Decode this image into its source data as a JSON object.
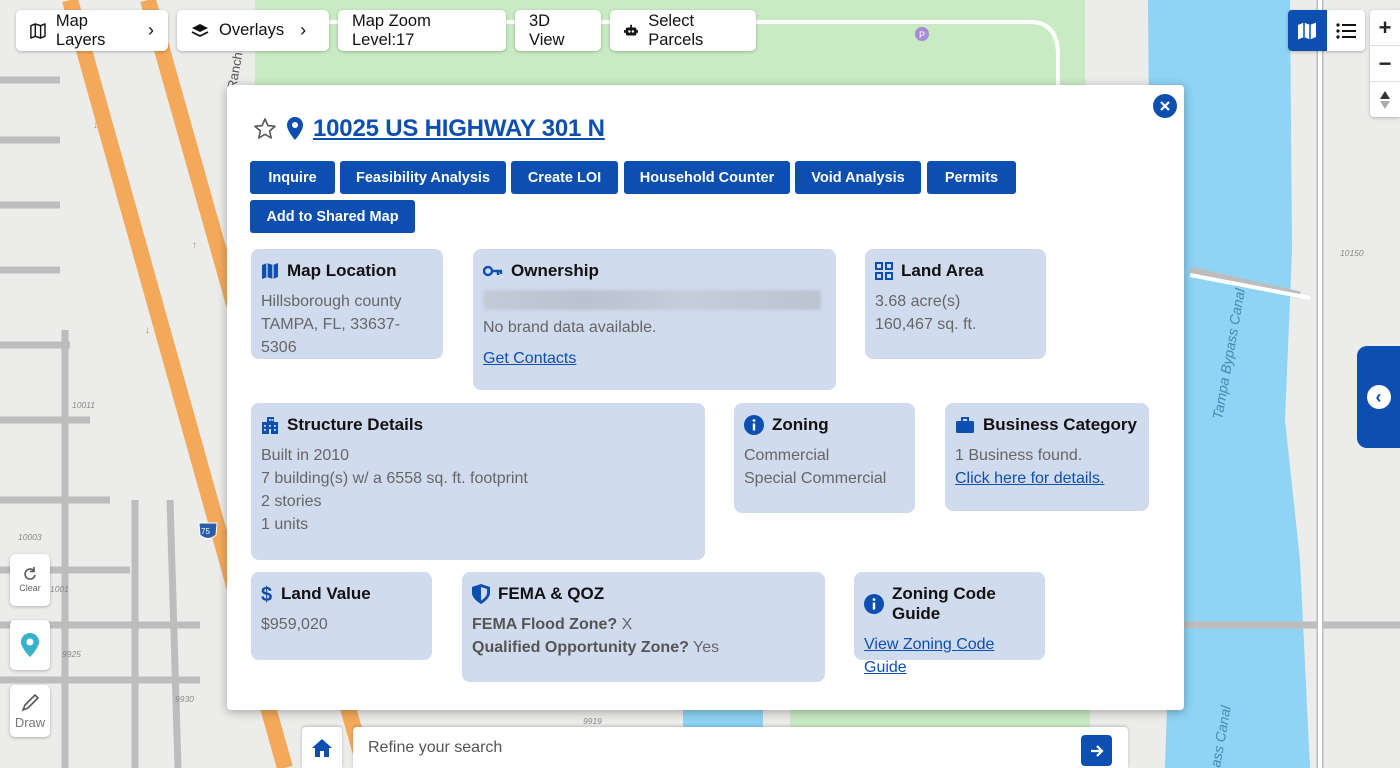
{
  "toolbar": {
    "map_layers": "Map Layers",
    "overlays": "Overlays",
    "zoom_level": "Map Zoom Level:17",
    "view_3d": "3D View",
    "select_parcels": "Select Parcels"
  },
  "map": {
    "labels": [
      "Ranch",
      "10011",
      "10003",
      "1001",
      "9925",
      "9930",
      "9919",
      "10150",
      "Tampa Bypass Canal",
      "ass Canal",
      "75"
    ],
    "clear_label": "Clear",
    "draw_label": "Draw"
  },
  "property": {
    "address": "10025 US HIGHWAY 301 N",
    "actions": [
      "Inquire",
      "Feasibility Analysis",
      "Create LOI",
      "Household Counter",
      "Void Analysis",
      "Permits",
      "Add to Shared Map"
    ],
    "map_location": {
      "title": "Map Location",
      "county": "Hillsborough county",
      "city": "TAMPA, FL, 33637-5306"
    },
    "ownership": {
      "title": "Ownership",
      "brand": "No brand data available.",
      "link": "Get Contacts"
    },
    "land_area": {
      "title": "Land Area",
      "acres": "3.68 acre(s)",
      "sqft": "160,467 sq. ft."
    },
    "structure": {
      "title": "Structure Details",
      "built": "Built in 2010",
      "buildings": "7 building(s) w/ a 6558 sq. ft. footprint",
      "stories": "2 stories",
      "units": "1 units"
    },
    "zoning": {
      "title": "Zoning",
      "line1": "Commercial",
      "line2": "Special Commercial"
    },
    "business": {
      "title": "Business Category",
      "found": "1 Business found.",
      "link": "Click here for details."
    },
    "land_value": {
      "title": "Land Value",
      "value": "$959,020"
    },
    "fema": {
      "title": "FEMA & QOZ",
      "flood_label": "FEMA Flood Zone?",
      "flood_value": "X",
      "qoz_label": "Qualified Opportunity Zone?",
      "qoz_value": "Yes"
    },
    "zoning_guide": {
      "title": "Zoning Code Guide",
      "link": "View Zoning Code Guide"
    }
  },
  "search": {
    "placeholder": "Refine your search"
  },
  "colors": {
    "primary": "#0d4fb0",
    "card_bg": "#d0dbee",
    "highway": "#f4a95a",
    "water": "#8fd3f5",
    "park": "#c9ebc4"
  }
}
